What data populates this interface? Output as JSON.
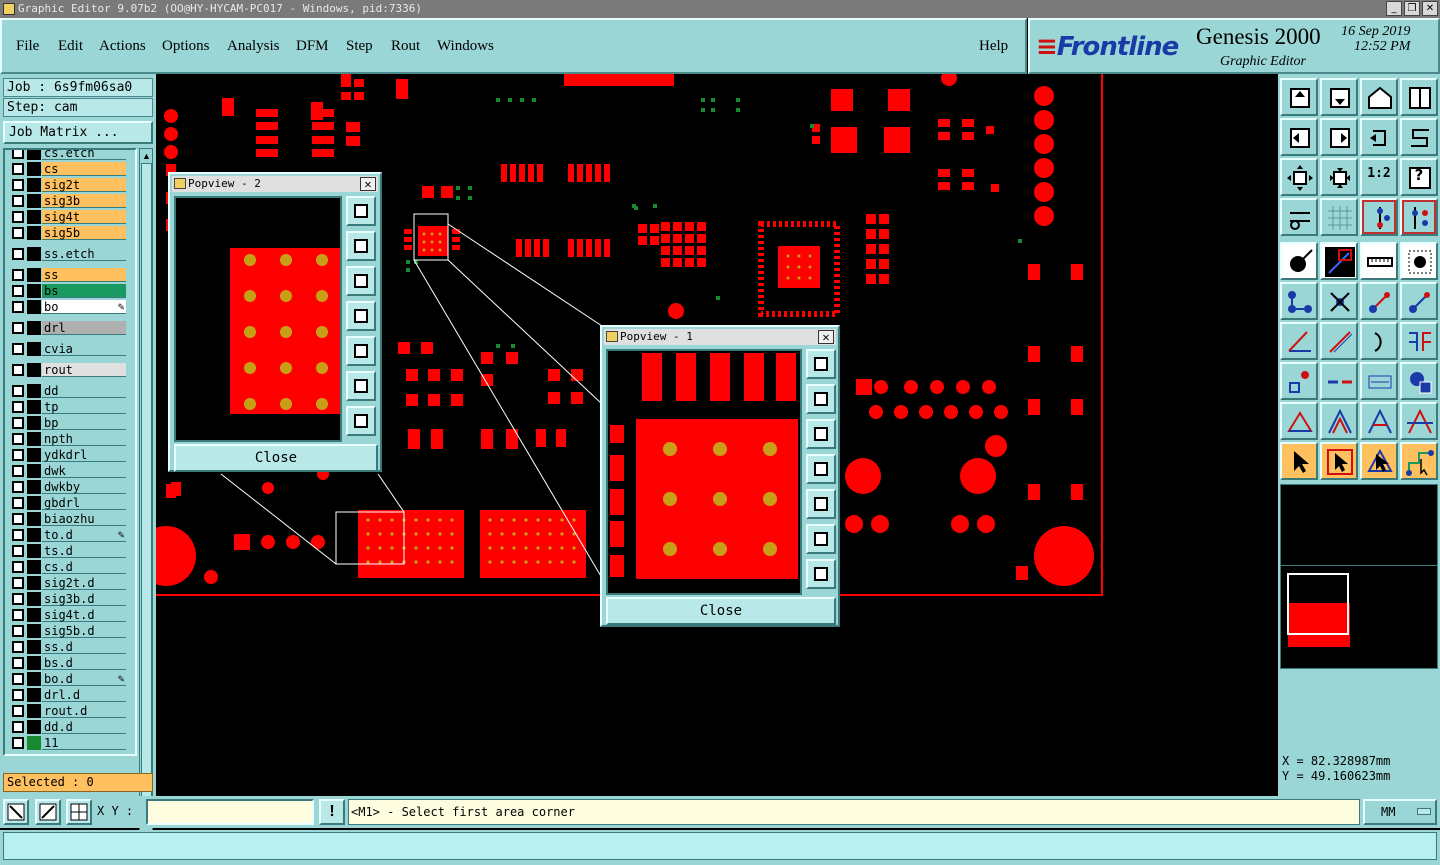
{
  "window": {
    "title": "Graphic Editor 9.07b2 (OO@HY-HYCAM-PC017 - Windows, pid:7336)",
    "controls": [
      "_",
      "❐",
      "✕"
    ]
  },
  "menu": {
    "items": [
      "File",
      "Edit",
      "Actions",
      "Options",
      "Analysis",
      "DFM",
      "Step",
      "Rout",
      "Windows"
    ],
    "help": "Help"
  },
  "brand": {
    "logo": "Frontline",
    "product": "Genesis 2000",
    "subtitle": "Graphic Editor",
    "date": "16 Sep 2019",
    "time": "12:52 PM"
  },
  "job": {
    "job_line": "Job : 6s9fm06sa0",
    "step_line": "Step: cam",
    "matrix_button": "Job Matrix ..."
  },
  "layers": [
    {
      "name": "cs.etch",
      "color": "#9ad6d6",
      "swatch": "#000000"
    },
    {
      "name": "cs",
      "color": "#ffc060",
      "swatch": "#000000"
    },
    {
      "name": "sig2t",
      "color": "#ffc060",
      "swatch": "#000000"
    },
    {
      "name": "sig3b",
      "color": "#ffc060",
      "swatch": "#000000"
    },
    {
      "name": "sig4t",
      "color": "#ffc060",
      "swatch": "#000000"
    },
    {
      "name": "sig5b",
      "color": "#ffc060",
      "swatch": "#000000"
    },
    {
      "name": "ss.etch",
      "color": "#9ad6d6",
      "swatch": "#000000",
      "gap": true
    },
    {
      "name": "ss",
      "color": "#ffc060",
      "swatch": "#000000",
      "gap": true
    },
    {
      "name": "bs",
      "color": "#1a9a60",
      "swatch": "#000000"
    },
    {
      "name": "bo",
      "color": "#ffffff",
      "swatch": "#000000",
      "pencil": "✎"
    },
    {
      "name": "drl",
      "color": "#b0b0b0",
      "swatch": "#000000",
      "gap": true
    },
    {
      "name": "cvia",
      "color": "#9ad6d6",
      "swatch": "#000000",
      "gap": true
    },
    {
      "name": "rout",
      "color": "#e0e0e0",
      "swatch": "#000000",
      "gap": true
    },
    {
      "name": "dd",
      "color": "#9ad6d6",
      "swatch": "#000000",
      "gap": true
    },
    {
      "name": "tp",
      "color": "#9ad6d6",
      "swatch": "#000000"
    },
    {
      "name": "bp",
      "color": "#9ad6d6",
      "swatch": "#000000"
    },
    {
      "name": "npth",
      "color": "#9ad6d6",
      "swatch": "#000000"
    },
    {
      "name": "ydkdrl",
      "color": "#9ad6d6",
      "swatch": "#000000"
    },
    {
      "name": "dwk",
      "color": "#9ad6d6",
      "swatch": "#000000"
    },
    {
      "name": "dwkby",
      "color": "#9ad6d6",
      "swatch": "#000000"
    },
    {
      "name": "gbdrl",
      "color": "#9ad6d6",
      "swatch": "#000000"
    },
    {
      "name": "biaozhu",
      "color": "#9ad6d6",
      "swatch": "#000000"
    },
    {
      "name": "to.d",
      "color": "#9ad6d6",
      "swatch": "#000000",
      "pencil": "✎"
    },
    {
      "name": "ts.d",
      "color": "#9ad6d6",
      "swatch": "#000000"
    },
    {
      "name": "cs.d",
      "color": "#9ad6d6",
      "swatch": "#000000"
    },
    {
      "name": "sig2t.d",
      "color": "#9ad6d6",
      "swatch": "#000000"
    },
    {
      "name": "sig3b.d",
      "color": "#9ad6d6",
      "swatch": "#000000"
    },
    {
      "name": "sig4t.d",
      "color": "#9ad6d6",
      "swatch": "#000000"
    },
    {
      "name": "sig5b.d",
      "color": "#9ad6d6",
      "swatch": "#000000"
    },
    {
      "name": "ss.d",
      "color": "#9ad6d6",
      "swatch": "#000000"
    },
    {
      "name": "bs.d",
      "color": "#9ad6d6",
      "swatch": "#000000"
    },
    {
      "name": "bo.d",
      "color": "#9ad6d6",
      "swatch": "#000000",
      "pencil": "✎"
    },
    {
      "name": "drl.d",
      "color": "#9ad6d6",
      "swatch": "#000000"
    },
    {
      "name": "rout.d",
      "color": "#9ad6d6",
      "swatch": "#000000"
    },
    {
      "name": "dd.d",
      "color": "#9ad6d6",
      "swatch": "#000000"
    },
    {
      "name": "11",
      "color": "#9ad6d6",
      "swatch": "#1a8a30"
    }
  ],
  "selected": "Selected : 0",
  "popview2": {
    "title": "Popview - 2",
    "close": "Close"
  },
  "popview1": {
    "title": "Popview - 1",
    "close": "Close"
  },
  "popview_tools": [
    "zoom-window-icon",
    "pan-up-icon",
    "pan-down-icon",
    "pan-left-icon",
    "pan-right-icon",
    "zoom-out-icon",
    "zoom-in-icon"
  ],
  "tools": {
    "ratio_label": "1:2",
    "help_label": "?"
  },
  "coords": {
    "x": "X = 82.328987mm",
    "y": "Y = 49.160623mm"
  },
  "bottom": {
    "xy_label": "X Y :",
    "xy_value": "",
    "message_icon": "!",
    "message": "<M1> - Select first area corner",
    "units": "MM"
  },
  "status": "",
  "colors": {
    "copper": "#ff0000",
    "pad_gold": "#c8a018",
    "panel": "#9ad6d6",
    "via_green": "#1a8a30"
  }
}
